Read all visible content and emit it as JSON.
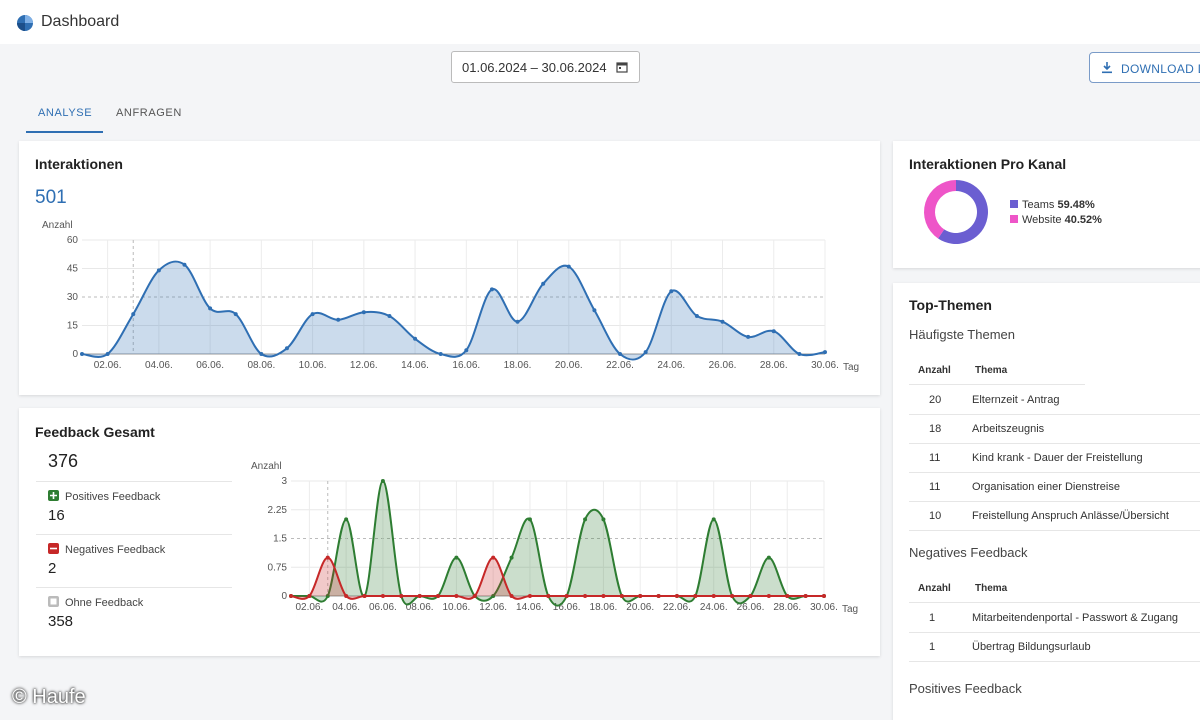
{
  "app": {
    "title": "Dashboard"
  },
  "toolbar": {
    "date_range": "01.06.2024 – 30.06.2024",
    "download_label": "DOWNLOAD D"
  },
  "tabs": [
    {
      "label": "ANALYSE"
    },
    {
      "label": "ANFRAGEN"
    }
  ],
  "interaktionen": {
    "title": "Interaktionen",
    "total": "501"
  },
  "feedback": {
    "title": "Feedback Gesamt",
    "total": "376",
    "positive_label": "Positives Feedback",
    "positive_count": "16",
    "negative_label": "Negatives Feedback",
    "negative_count": "2",
    "none_label": "Ohne Feedback",
    "none_count": "358"
  },
  "kanal": {
    "title": "Interaktionen Pro Kanal",
    "teams_label": "Teams",
    "teams_value": "59.48%",
    "website_label": "Website",
    "website_value": "40.52%"
  },
  "top_themen": {
    "title": "Top-Themen",
    "haeufigste_title": "Häufigste Themen",
    "negativ_title": "Negatives Feedback",
    "positiv_title": "Positives Feedback",
    "col_anzahl": "Anzahl",
    "col_thema": "Thema",
    "haeufigste": [
      {
        "anzahl": "20",
        "thema": "Elternzeit - Antrag"
      },
      {
        "anzahl": "18",
        "thema": "Arbeitszeugnis"
      },
      {
        "anzahl": "11",
        "thema": "Kind krank - Dauer der Freistellung"
      },
      {
        "anzahl": "11",
        "thema": "Organisation einer Dienstreise"
      },
      {
        "anzahl": "10",
        "thema": "Freistellung Anspruch Anlässe/Übersicht"
      }
    ],
    "negativ": [
      {
        "anzahl": "1",
        "thema": "Mitarbeitendenportal - Passwort & Zugang"
      },
      {
        "anzahl": "1",
        "thema": "Übertrag Bildungsurlaub"
      }
    ]
  },
  "watermark": "© Haufe",
  "colors": {
    "accent": "#2f6fb3",
    "teams": "#6b5ed1",
    "website": "#ee55c8",
    "positive": "#2e7d32",
    "negative": "#c62828"
  },
  "chart_data": [
    {
      "type": "area",
      "title": "Interaktionen",
      "xlabel": "Tag",
      "ylabel": "Anzahl",
      "ylim": [
        0,
        60
      ],
      "yticks": [
        0,
        15,
        30,
        45,
        60
      ],
      "xticks": [
        "02.06.",
        "04.06.",
        "06.06.",
        "08.06.",
        "10.06.",
        "12.06.",
        "14.06.",
        "16.06.",
        "18.06.",
        "20.06.",
        "22.06.",
        "24.06.",
        "26.06.",
        "28.06.",
        "30.06."
      ],
      "x": [
        1,
        2,
        3,
        4,
        5,
        6,
        7,
        8,
        9,
        10,
        11,
        12,
        13,
        14,
        15,
        16,
        17,
        18,
        19,
        20,
        21,
        22,
        23,
        24,
        25,
        26,
        27,
        28,
        29,
        30
      ],
      "values": [
        0,
        0,
        21,
        44,
        47,
        24,
        21,
        0,
        3,
        21,
        18,
        22,
        20,
        8,
        0,
        2,
        34,
        17,
        37,
        46,
        23,
        0,
        1,
        33,
        20,
        17,
        9,
        12,
        0,
        1
      ],
      "grid": true
    },
    {
      "type": "area",
      "title": "Feedback",
      "xlabel": "Tag",
      "ylabel": "Anzahl",
      "ylim": [
        0,
        3
      ],
      "yticks": [
        0,
        0.75,
        1.5,
        2.25,
        3
      ],
      "xticks": [
        "02.06.",
        "04.06.",
        "06.06.",
        "08.06.",
        "10.06.",
        "12.06.",
        "14.06.",
        "16.06.",
        "18.06.",
        "20.06.",
        "22.06.",
        "24.06.",
        "26.06.",
        "28.06.",
        "30.06."
      ],
      "x": [
        1,
        2,
        3,
        4,
        5,
        6,
        7,
        8,
        9,
        10,
        11,
        12,
        13,
        14,
        15,
        16,
        17,
        18,
        19,
        20,
        21,
        22,
        23,
        24,
        25,
        26,
        27,
        28,
        29,
        30
      ],
      "series": [
        {
          "name": "Positives Feedback",
          "values": [
            0,
            0,
            0,
            2,
            0,
            3,
            0,
            0,
            0,
            1,
            0,
            0,
            1,
            2,
            0,
            0,
            2,
            2,
            0,
            0,
            0,
            0,
            0,
            2,
            0,
            0,
            1,
            0,
            0,
            0
          ]
        },
        {
          "name": "Negatives Feedback",
          "values": [
            0,
            0,
            1,
            0,
            0,
            0,
            0,
            0,
            0,
            0,
            0,
            1,
            0,
            0,
            0,
            0,
            0,
            0,
            0,
            0,
            0,
            0,
            0,
            0,
            0,
            0,
            0,
            0,
            0,
            0
          ]
        }
      ],
      "grid": true
    },
    {
      "type": "pie",
      "title": "Interaktionen Pro Kanal",
      "categories": [
        "Teams",
        "Website"
      ],
      "values": [
        59.48,
        40.52
      ]
    }
  ]
}
